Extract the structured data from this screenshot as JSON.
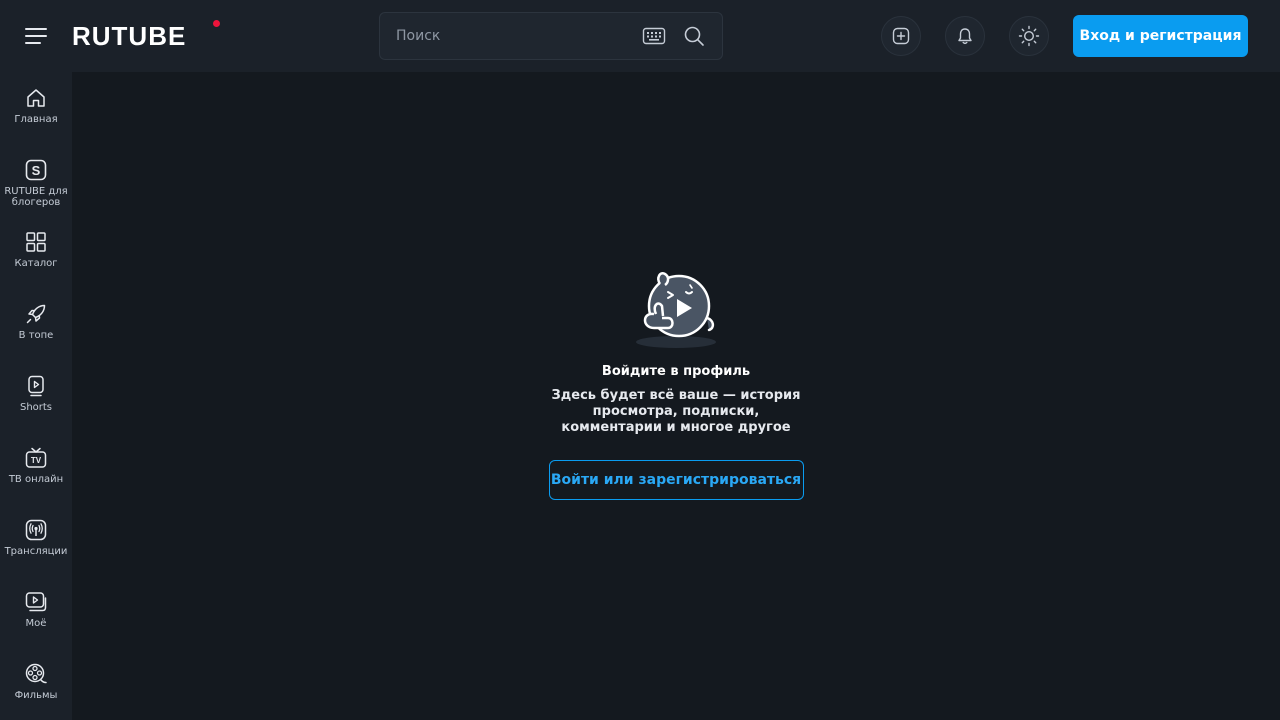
{
  "header": {
    "logo_text": "RUTUBE",
    "search_placeholder": "Поиск",
    "login_button": "Вход и регистрация",
    "icons": [
      "menu-icon",
      "keyboard-icon",
      "search-icon",
      "upload-icon",
      "bell-icon",
      "theme-icon"
    ]
  },
  "sidebar": {
    "items": [
      {
        "label": "Главная",
        "icon": "home-icon"
      },
      {
        "label": "RUTUBE для блогеров",
        "icon": "studio-icon"
      },
      {
        "label": "Каталог",
        "icon": "catalog-icon"
      },
      {
        "label": "В топе",
        "icon": "rocket-icon"
      },
      {
        "label": "Shorts",
        "icon": "shorts-icon"
      },
      {
        "label": "ТВ онлайн",
        "icon": "tv-icon"
      },
      {
        "label": "Трансляции",
        "icon": "broadcast-icon"
      },
      {
        "label": "Моё",
        "icon": "my-videos-icon"
      },
      {
        "label": "Фильмы",
        "icon": "film-reel-icon"
      }
    ]
  },
  "empty_state": {
    "title": "Войдите в профиль",
    "description": "Здесь будет всё ваше — история просмотра, подписки, комментарии и многое другое",
    "button": "Войти или зарегистрироваться"
  },
  "colors": {
    "background": "#14191f",
    "panel": "#1b2129",
    "accent": "#0a9cf0",
    "logo_dot": "#ed143b"
  }
}
